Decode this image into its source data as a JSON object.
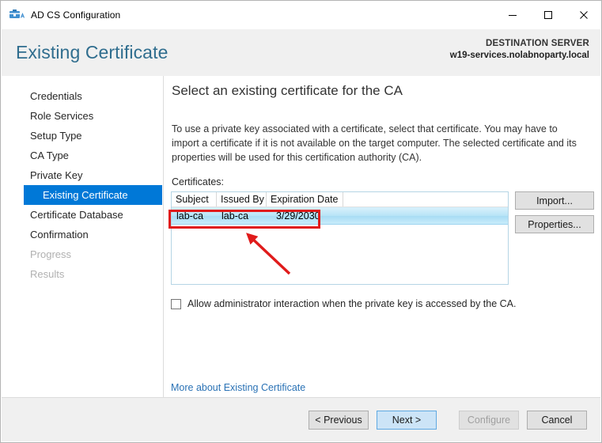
{
  "window": {
    "title": "AD CS Configuration",
    "icon": "adcs-icon",
    "minimize_label": "‒",
    "maximize_label": "☐",
    "close_label": "✕"
  },
  "header": {
    "page_title": "Existing Certificate",
    "destination_label": "DESTINATION SERVER",
    "destination_server": "w19-services.nolabnoparty.local",
    "title_color": "#2f6d8e"
  },
  "sidebar": {
    "items": [
      {
        "label": "Credentials",
        "state": "normal",
        "sub": false
      },
      {
        "label": "Role Services",
        "state": "normal",
        "sub": false
      },
      {
        "label": "Setup Type",
        "state": "normal",
        "sub": false
      },
      {
        "label": "CA Type",
        "state": "normal",
        "sub": false
      },
      {
        "label": "Private Key",
        "state": "normal",
        "sub": false
      },
      {
        "label": "Existing Certificate",
        "state": "selected",
        "sub": true
      },
      {
        "label": "Certificate Database",
        "state": "normal",
        "sub": false
      },
      {
        "label": "Confirmation",
        "state": "normal",
        "sub": false
      },
      {
        "label": "Progress",
        "state": "disabled",
        "sub": false
      },
      {
        "label": "Results",
        "state": "disabled",
        "sub": false
      }
    ],
    "selected_color": "#0078d7"
  },
  "main": {
    "heading": "Select an existing certificate for the CA",
    "description": "To use a private key associated with a certificate, select that certificate. You may have to import a certificate if it is not available on the target computer. The selected certificate and its properties will be used for this certification authority (CA).",
    "list_label": "Certificates:",
    "certificates_table": {
      "columns": [
        "Subject",
        "Issued By",
        "Expiration Date"
      ],
      "rows": [
        {
          "subject": "lab-ca",
          "issued_by": "lab-ca",
          "expiration_date": "3/29/2030",
          "selected": true
        }
      ]
    },
    "import_button": "Import...",
    "properties_button": "Properties...",
    "checkbox": {
      "label": "Allow administrator interaction when the private key is accessed by the CA.",
      "checked": false
    },
    "more_link": "More about Existing Certificate"
  },
  "footer": {
    "previous": "< Previous",
    "next": "Next >",
    "configure": "Configure",
    "cancel": "Cancel",
    "configure_enabled": false
  },
  "annotations": {
    "highlight_color": "#e01b1b",
    "rectangle_target": "selected certificate row",
    "arrow_target": "selected certificate row"
  }
}
